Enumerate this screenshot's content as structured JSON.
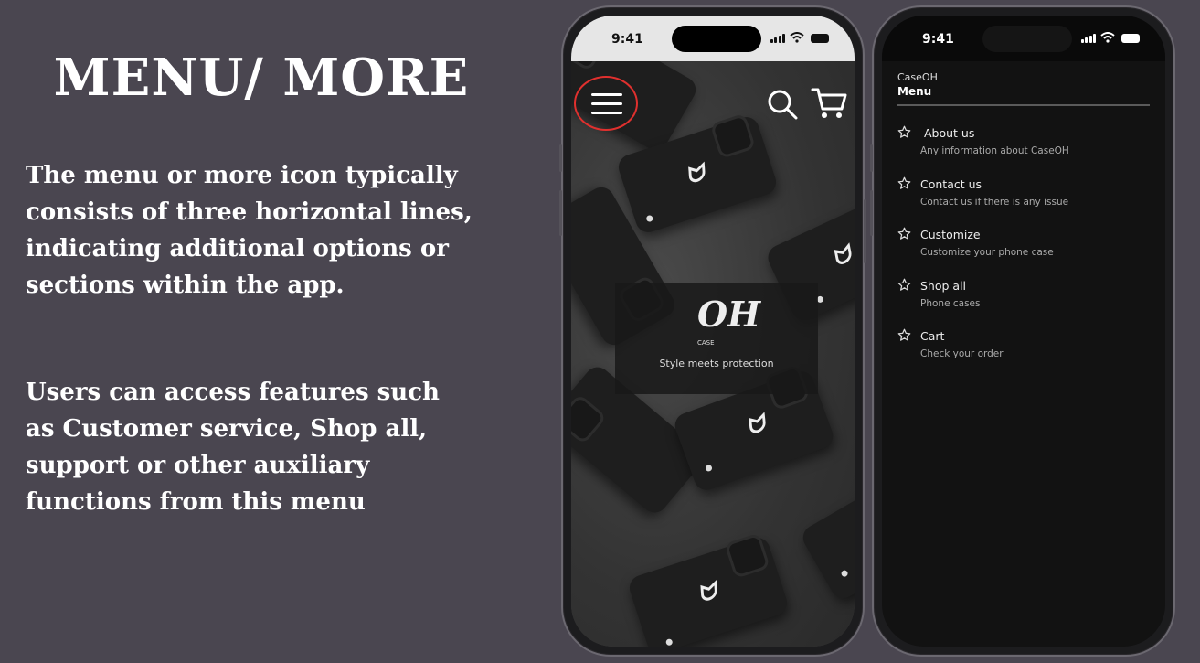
{
  "slide": {
    "title": "MENU/ MORE",
    "paragraph1": "The menu or more icon typically consists of three horizontal lines, indicating additional options or sections within the app.",
    "paragraph2": "Users can access features such as Customer service, Shop all, support or other auxiliary functions from this menu"
  },
  "phone_home": {
    "time": "9:41",
    "logo_text": "OH",
    "logo_case": "CASE",
    "tagline": "Style meets protection",
    "icons": [
      "menu-icon",
      "search-icon",
      "cart-icon"
    ],
    "highlight_color": "#e0302e"
  },
  "phone_menu": {
    "time": "9:41",
    "brand": "CaseOH",
    "title": "Menu",
    "items": [
      {
        "label": "About us",
        "desc": "Any information about CaseOH"
      },
      {
        "label": "Contact us",
        "desc": "Contact us if there is any issue"
      },
      {
        "label": "Customize",
        "desc": "Customize your phone case"
      },
      {
        "label": "Shop all",
        "desc": "Phone cases"
      },
      {
        "label": "Cart",
        "desc": "Check your order"
      }
    ]
  }
}
